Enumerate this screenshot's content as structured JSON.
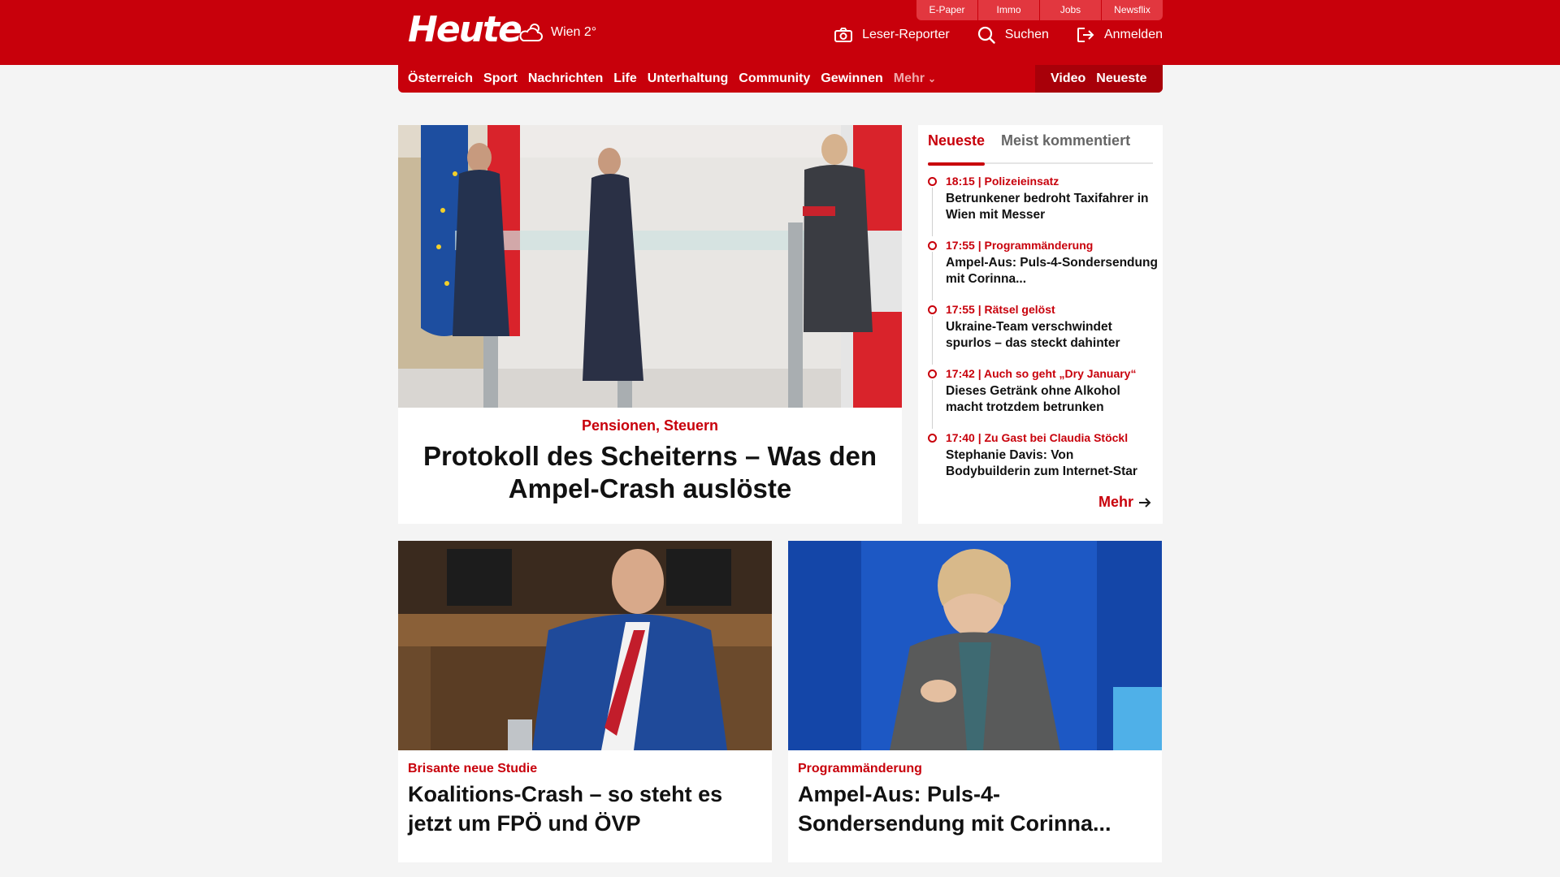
{
  "header": {
    "logo_text": "Heute",
    "weather": "Wien 2°",
    "service_tabs": [
      "E-Paper",
      "Immo",
      "Jobs",
      "Newsflix"
    ],
    "actions": {
      "reporter": "Leser-Reporter",
      "search": "Suchen",
      "login": "Anmelden"
    }
  },
  "nav": {
    "items": [
      "Österreich",
      "Sport",
      "Nachrichten",
      "Life",
      "Unterhaltung",
      "Community",
      "Gewinnen"
    ],
    "more": "Mehr",
    "right": [
      "Video",
      "Neueste"
    ]
  },
  "hero": {
    "kicker": "Pensionen, Steuern",
    "title": "Protokoll des Scheiterns – Was den Ampel-Crash auslöste"
  },
  "sidebar": {
    "tabs": [
      "Neueste",
      "Meist kommentiert"
    ],
    "items": [
      {
        "meta": "18:15 | Polizeieinsatz",
        "title": "Betrunkener bedroht Taxifahrer in Wien mit Messer"
      },
      {
        "meta": "17:55 | Programmänderung",
        "title": "Ampel-Aus: Puls-4-Sondersendung mit Corinna..."
      },
      {
        "meta": "17:55 | Rätsel gelöst",
        "title": "Ukraine-Team verschwindet spurlos – das steckt dahinter"
      },
      {
        "meta": "17:42 | Auch so geht „Dry January“",
        "title": "Dieses Getränk ohne Alkohol macht trotzdem betrunken"
      },
      {
        "meta": "17:40 | Zu Gast bei Claudia Stöckl",
        "title": "Stephanie Davis: Von Bodybuilderin zum Internet-Star"
      }
    ],
    "more": "Mehr"
  },
  "cards": [
    {
      "kicker": "Brisante neue Studie",
      "title": "Koalitions-Crash – so steht es jetzt um FPÖ und ÖVP"
    },
    {
      "kicker": "Programmänderung",
      "title": "Ampel-Aus: Puls-4-Sondersendung mit Corinna..."
    }
  ],
  "colors": {
    "brand_red": "#c8000b",
    "dark_red": "#a80009",
    "tab_red": "#e2373f",
    "page_bg": "#f4f4f4"
  }
}
